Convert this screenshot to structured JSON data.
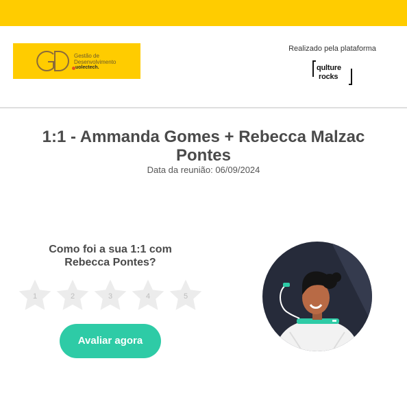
{
  "header": {
    "logo": {
      "letters": "GD",
      "line1": "Gestão de",
      "line2": "Desenvolvimento",
      "line3": "uolectech."
    },
    "platform_label": "Realizado pela plataforma",
    "platform_logo": {
      "line1": "qulture",
      "line2": "rocks"
    }
  },
  "meeting": {
    "title": "1:1 - Ammanda Gomes + Rebecca Malzac Pontes",
    "date": "Data da reunião: 06/09/2024"
  },
  "rating": {
    "question": "Como foi a sua 1:1 com Rebecca Pontes?",
    "stars": [
      "1",
      "2",
      "3",
      "4",
      "5"
    ],
    "button_label": "Avaliar agora"
  },
  "colors": {
    "brand_yellow": "#ffcc00",
    "accent_green": "#2ecba6",
    "star_grey": "#ececec",
    "illustration_navy": "#2b3040"
  },
  "icons": {
    "illustration": "astronaut-avatar-icon",
    "star": "star-icon"
  }
}
